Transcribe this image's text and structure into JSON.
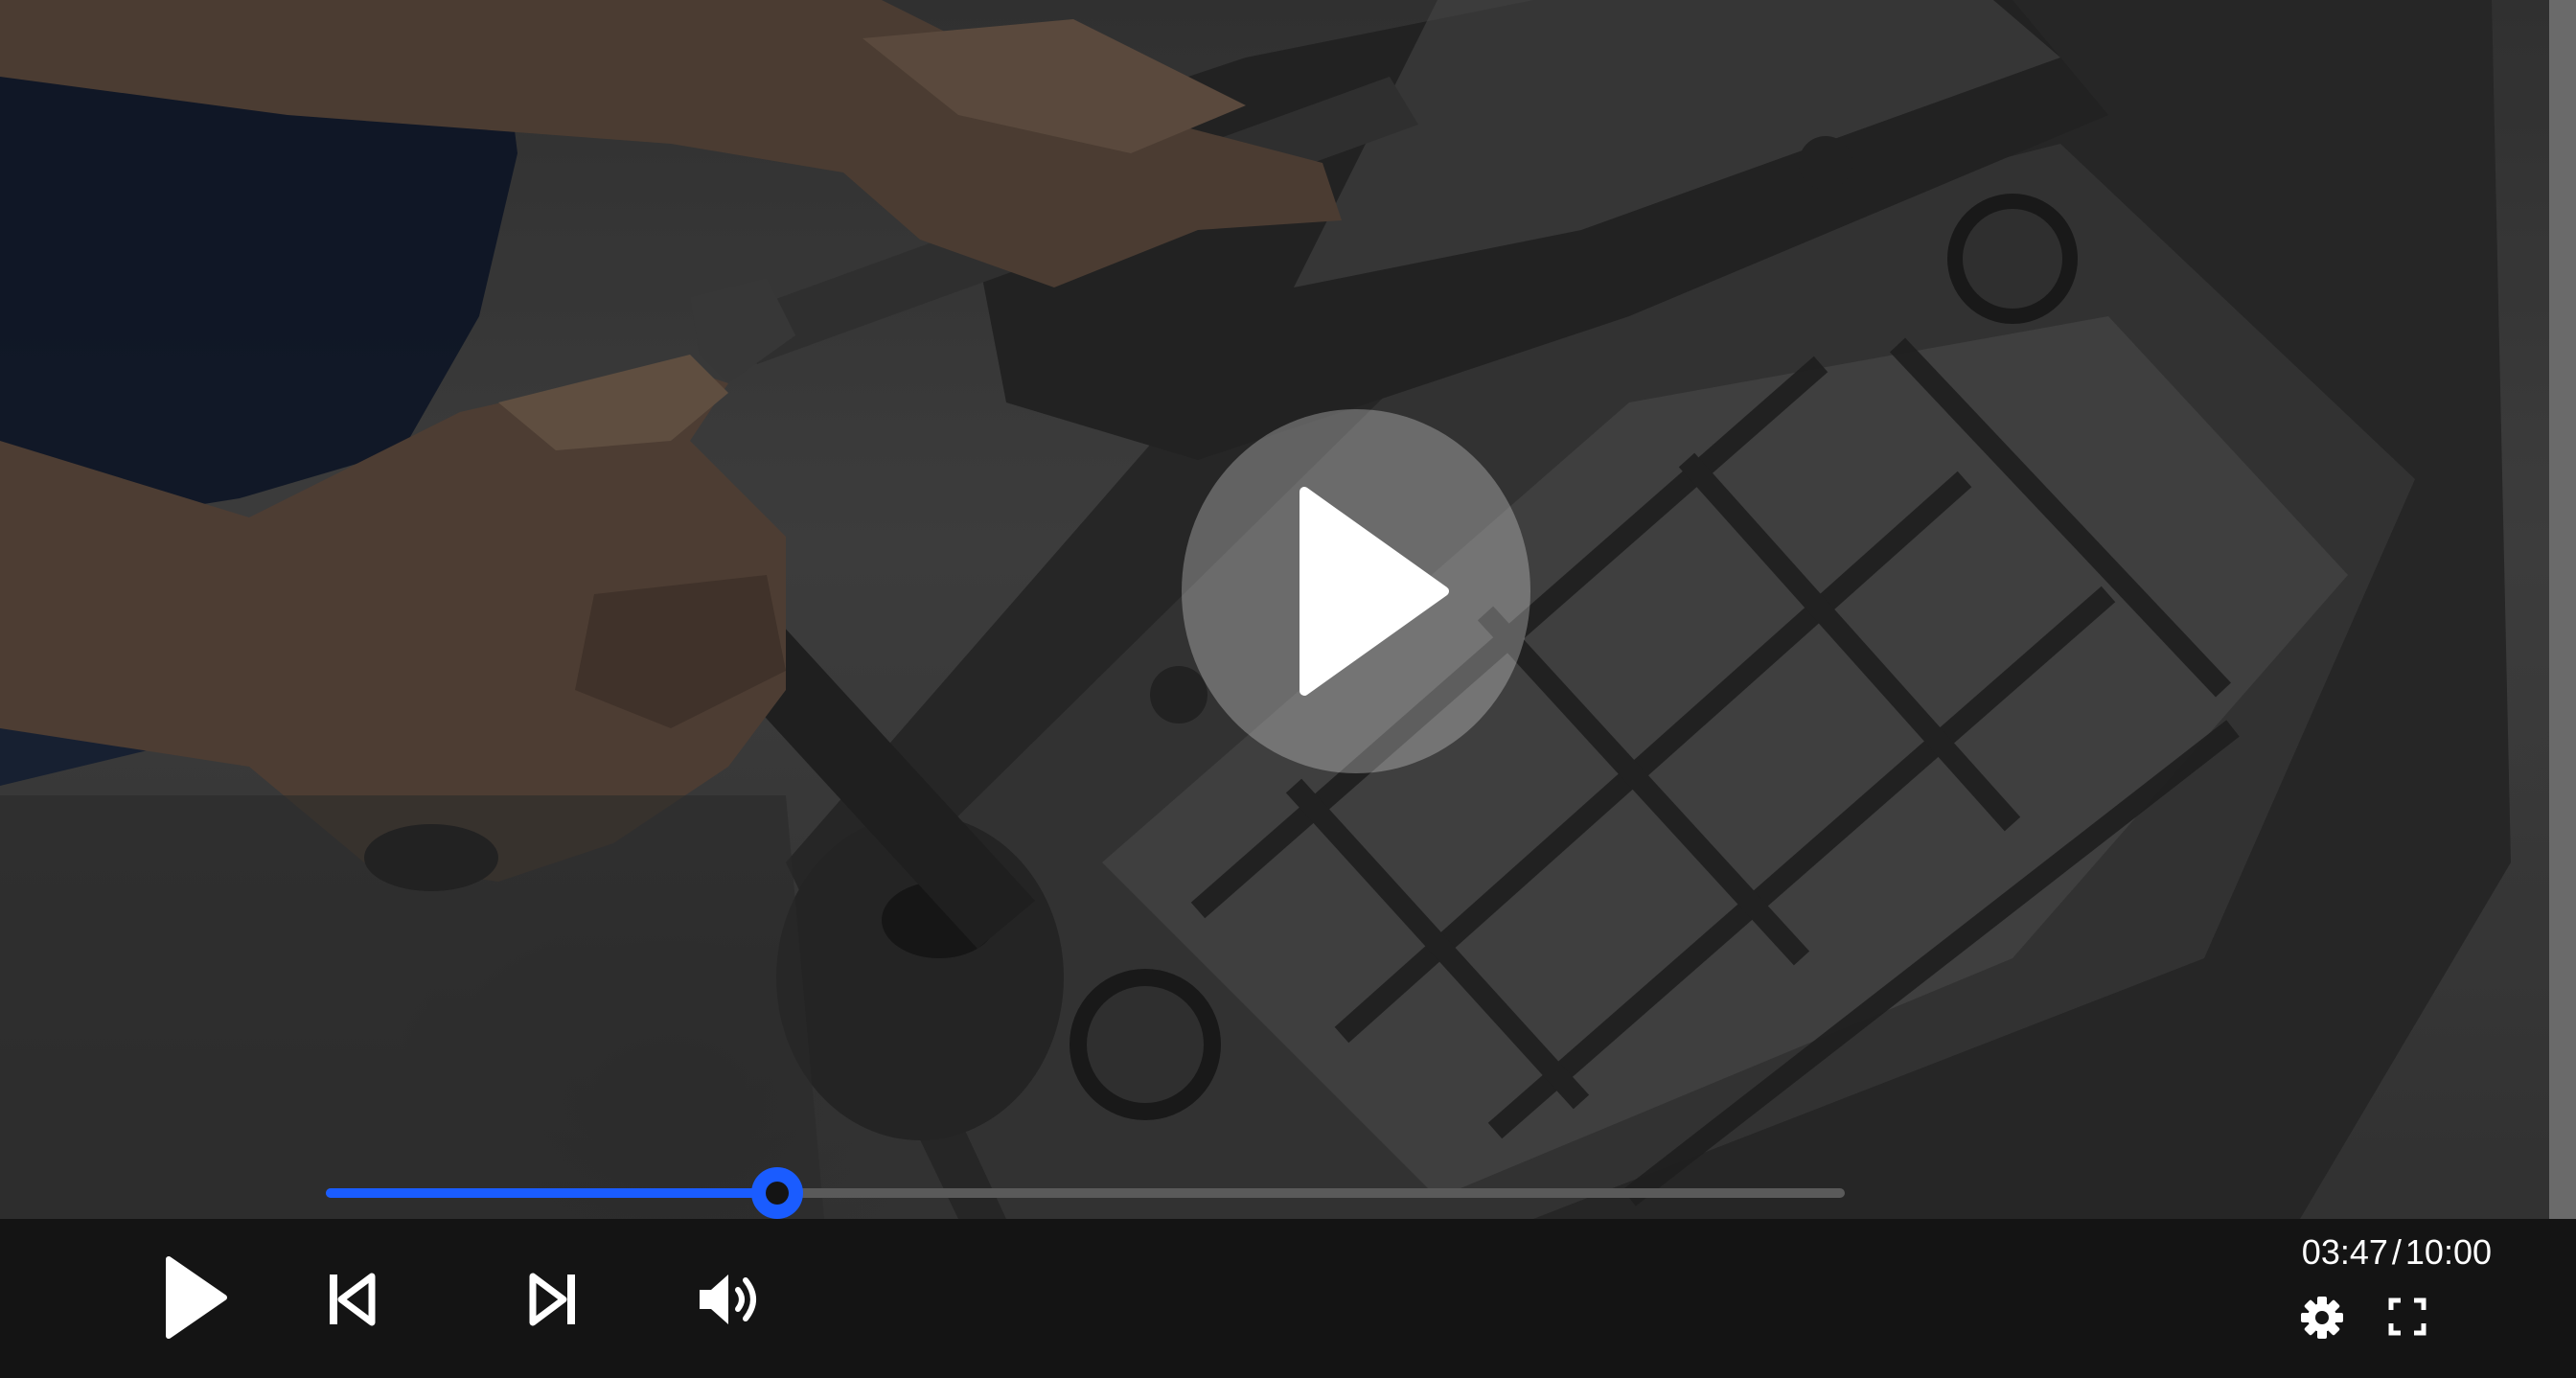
{
  "player": {
    "title": "",
    "video_description_icon": "engine-block-video-frame",
    "accent_color": "#1a5cff",
    "background_color": "#141414",
    "progress_fraction": 0.297,
    "is_playing": false,
    "time": {
      "current": "03:47",
      "separator": "/",
      "total": "10:00"
    },
    "icons": {
      "center_play": "play-icon",
      "play": "play-icon",
      "previous": "skip-previous-icon",
      "next": "skip-next-icon",
      "volume": "volume-icon",
      "settings": "gear-icon",
      "fullscreen": "fullscreen-icon"
    }
  }
}
